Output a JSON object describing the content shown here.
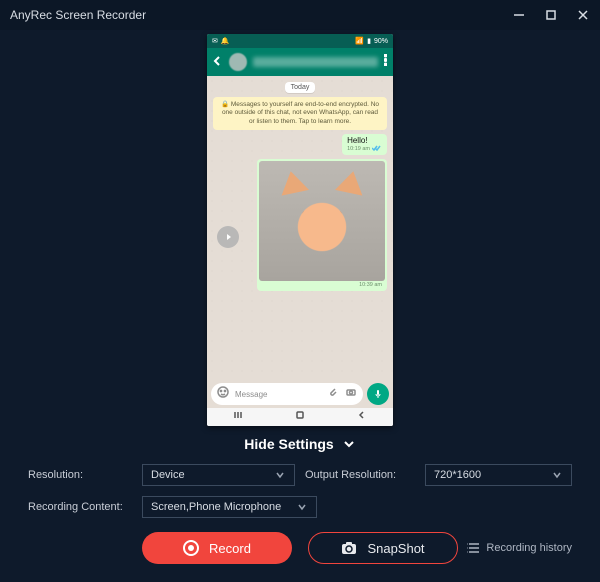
{
  "titlebar": {
    "title": "AnyRec Screen Recorder"
  },
  "phone": {
    "status": {
      "time": "",
      "battery": "90%"
    },
    "date_pill": "Today",
    "info_message": "🔒 Messages to yourself are end-to-end encrypted. No one outside of this chat, not even WhatsApp, can read or listen to them. Tap to learn more.",
    "msg1": {
      "text": "Hello!",
      "time": "10:19 am"
    },
    "img_msg": {
      "time": "10:39 am"
    },
    "input_placeholder": "Message"
  },
  "toggle_label": "Hide Settings",
  "settings": {
    "resolution_label": "Resolution:",
    "resolution_value": "Device",
    "output_label": "Output Resolution:",
    "output_value": "720*1600",
    "content_label": "Recording Content:",
    "content_value": "Screen,Phone Microphone"
  },
  "buttons": {
    "record": "Record",
    "snapshot": "SnapShot",
    "history": "Recording history"
  }
}
